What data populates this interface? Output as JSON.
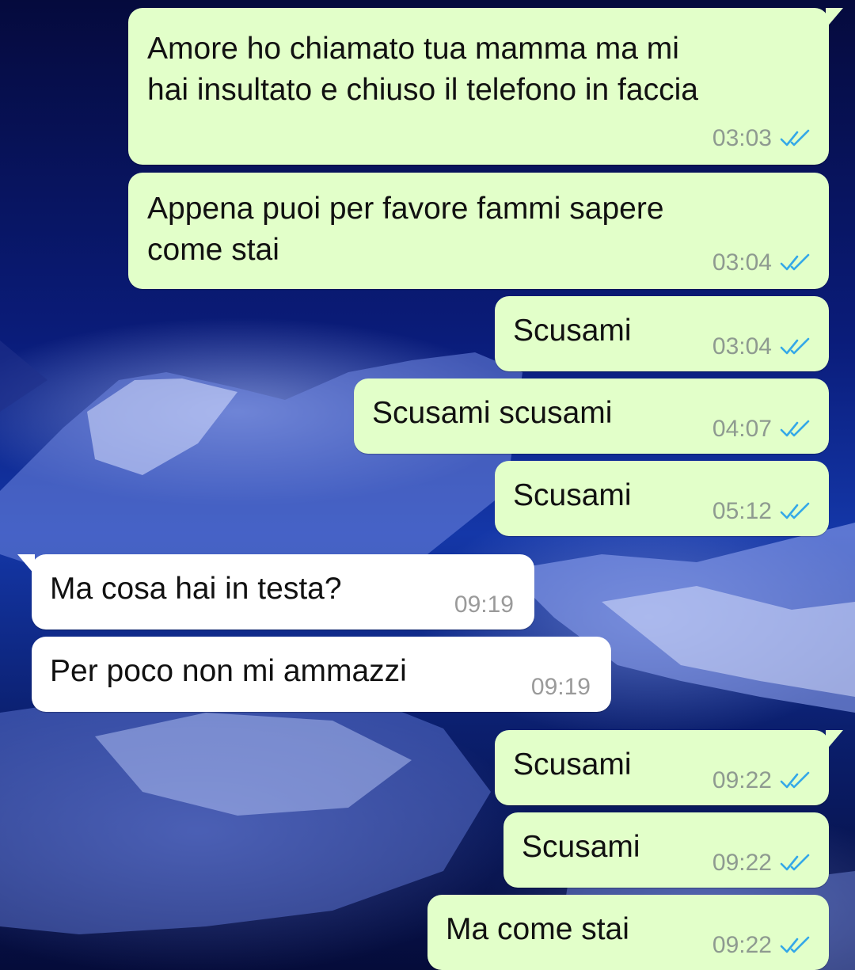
{
  "theme": {
    "outgoing_bubble": "#e2ffc9",
    "incoming_bubble": "#ffffff",
    "read_ticks": "#34a8e8"
  },
  "messages": [
    {
      "direction": "out",
      "text": "Amore ho chiamato tua mamma ma mi\nhai insultato e chiuso il telefono in faccia",
      "time": "03:03",
      "status": "read"
    },
    {
      "direction": "out",
      "text": "Appena puoi per favore fammi sapere\ncome stai",
      "time": "03:04",
      "status": "read"
    },
    {
      "direction": "out",
      "text": "Scusami",
      "time": "03:04",
      "status": "read"
    },
    {
      "direction": "out",
      "text": "Scusami scusami",
      "time": "04:07",
      "status": "read"
    },
    {
      "direction": "out",
      "text": "Scusami",
      "time": "05:12",
      "status": "read"
    },
    {
      "direction": "in",
      "text": "Ma cosa hai in testa?",
      "time": "09:19"
    },
    {
      "direction": "in",
      "text": "Per poco non mi ammazzi",
      "time": "09:19"
    },
    {
      "direction": "out",
      "text": "Scusami",
      "time": "09:22",
      "status": "read"
    },
    {
      "direction": "out",
      "text": "Scusami",
      "time": "09:22",
      "status": "read"
    },
    {
      "direction": "out",
      "text": "Ma come stai",
      "time": "09:22",
      "status": "read"
    }
  ]
}
